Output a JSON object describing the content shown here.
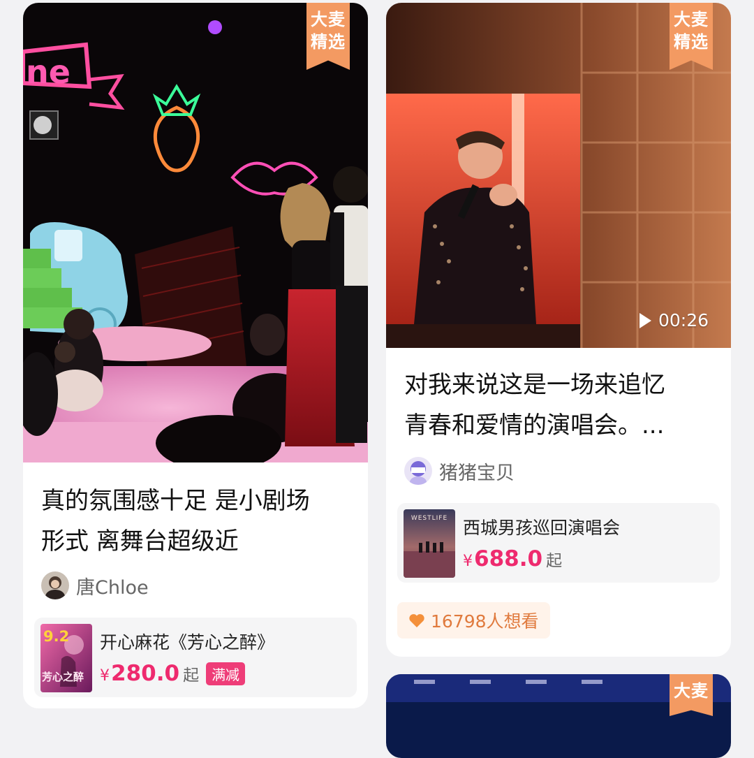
{
  "cards": {
    "left": {
      "badge": {
        "line1": "大麦",
        "line2": "精选"
      },
      "title_line1": "真的氛围感十足 是小剧场",
      "title_line2": "形式 离舞台超级近",
      "author": "唐Chloe",
      "product": {
        "name": "开心麻花《芳心之醉》",
        "score": "9.2",
        "poster_text": "芳心之醉",
        "price_symbol": "¥",
        "price": "280.0",
        "price_suffix": "起",
        "promo": "满减"
      }
    },
    "right": {
      "badge": {
        "line1": "大麦",
        "line2": "精选"
      },
      "duration": "00:26",
      "title_line1": "对我来说这是一场来追忆",
      "title_line2": "青春和爱情的演唱会。...",
      "author": "猪猪宝贝",
      "product": {
        "name": "西城男孩巡回演唱会",
        "poster_text": "WESTLIFE",
        "price_symbol": "¥",
        "price": "688.0",
        "price_suffix": "起"
      },
      "want_count": "16798人想看"
    },
    "next": {
      "badge": {
        "line1": "大麦"
      }
    }
  },
  "colors": {
    "accent_price": "#ee2a6e",
    "badge": "#f39a62",
    "want_text": "#e07a3d"
  }
}
